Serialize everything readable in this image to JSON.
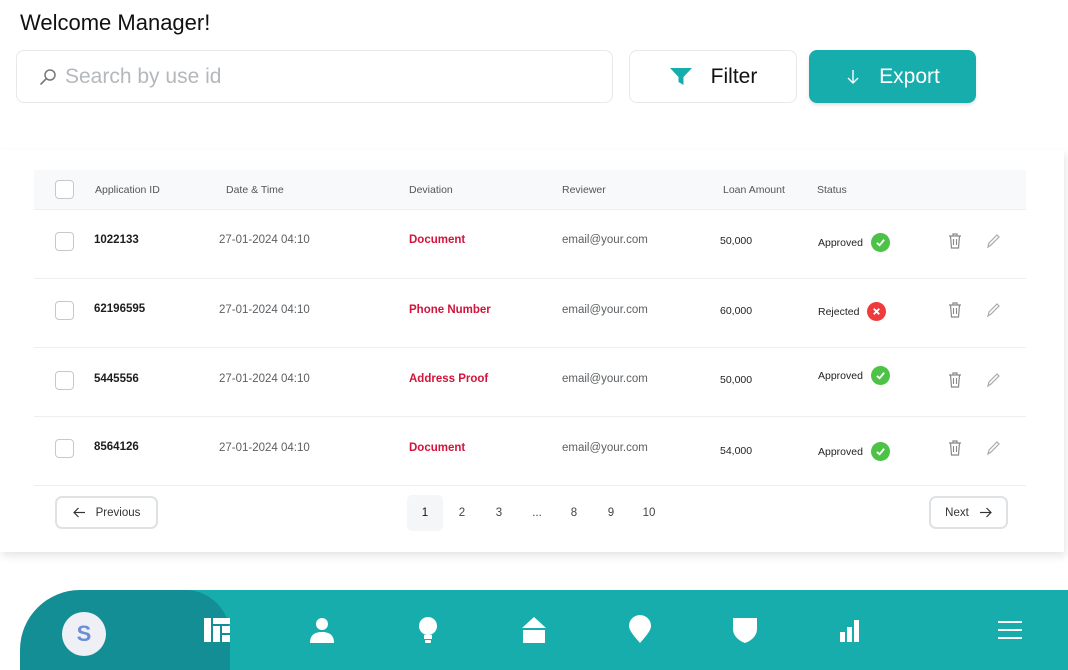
{
  "header": {
    "welcome": "Welcome Manager!"
  },
  "search": {
    "placeholder": "Search by use id",
    "value": ""
  },
  "toolbar": {
    "filter_label": "Filter",
    "export_label": "Export"
  },
  "table": {
    "columns": [
      "Application ID",
      "Date & Time",
      "Deviation",
      "Reviewer",
      "Loan Amount",
      "Status"
    ],
    "rows": [
      {
        "id": "1022133",
        "datetime": "27-01-2024 04:10",
        "deviation": "Document",
        "reviewer": "email@your.com",
        "amount": "50,000",
        "status": "Approved"
      },
      {
        "id": "62196595",
        "datetime": "27-01-2024 04:10",
        "deviation": "Phone Number",
        "reviewer": "email@your.com",
        "amount": "60,000",
        "status": "Rejected"
      },
      {
        "id": "5445556",
        "datetime": "27-01-2024 04:10",
        "deviation": "Address Proof",
        "reviewer": "email@your.com",
        "amount": "50,000",
        "status": "Approved"
      },
      {
        "id": "8564126",
        "datetime": "27-01-2024 04:10",
        "deviation": "Document",
        "reviewer": "email@your.com",
        "amount": "54,000",
        "status": "Approved"
      }
    ]
  },
  "pagination": {
    "previous_label": "Previous",
    "next_label": "Next",
    "pages": [
      "1",
      "2",
      "3",
      "...",
      "8",
      "9",
      "10"
    ],
    "current": "1"
  },
  "bottom_nav": {
    "avatar_initial": "S",
    "icons": [
      "dashboard-icon",
      "user-icon",
      "lightbulb-icon",
      "home-icon",
      "location-pin-icon",
      "shield-icon",
      "bar-chart-icon",
      "menu-icon"
    ]
  },
  "colors": {
    "accent": "#17adad",
    "accent_dark": "#138e95",
    "deviation": "#d1143b",
    "approved": "#4cc246",
    "rejected": "#ef3b3b"
  }
}
